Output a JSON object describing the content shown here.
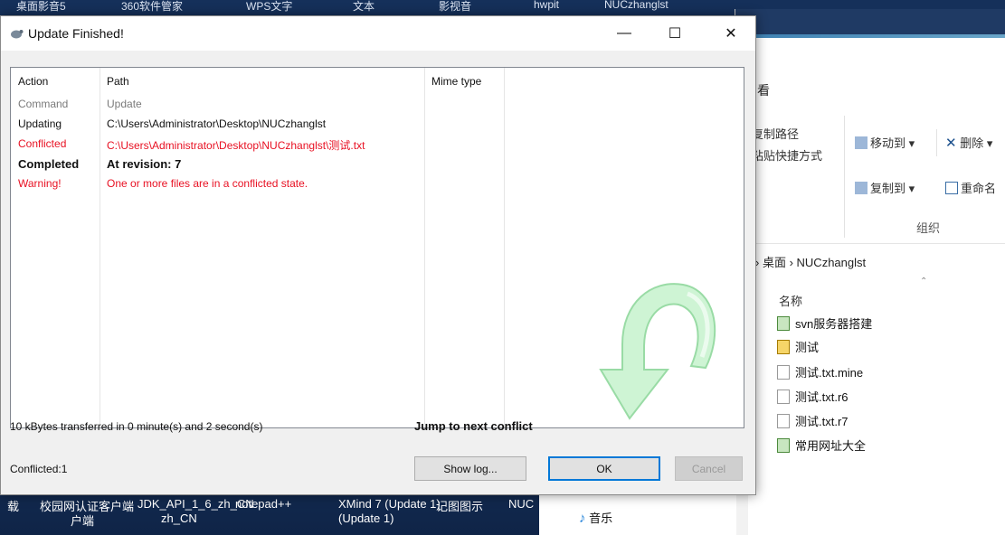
{
  "desktop": {
    "top_strip": [
      "桌面影音5",
      "360软件管家",
      "WPS文字",
      "文本",
      "影视音",
      "hwpit",
      "NUCzhanglst"
    ],
    "bottom_items": [
      "载",
      "校园网认证客户端",
      "JDK_API_1_6_zh_CN",
      "notepad++",
      "XMind 7 (Update 1)",
      "记图图示",
      "NUC"
    ],
    "bottom_labels": [
      "户端",
      "zh_CN",
      "(Update 1)"
    ]
  },
  "explorer": {
    "ribbon_tab": "看",
    "copy_path": "复制路径",
    "paste_shortcut": "粘贴快捷方式",
    "move_to": "移动到",
    "delete": "删除",
    "copy_to": "复制到",
    "rename": "重命名",
    "group_label": "组织",
    "breadcrumb": [
      "桌面",
      "NUCzhanglst"
    ],
    "column_name": "名称",
    "files": [
      {
        "name": "svn服务器搭建",
        "icon": "svn-file-icon"
      },
      {
        "name": "测试",
        "icon": "conflict-file-icon"
      },
      {
        "name": "测试.txt.mine",
        "icon": "text-file-icon"
      },
      {
        "name": "测试.txt.r6",
        "icon": "text-file-icon"
      },
      {
        "name": "测试.txt.r7",
        "icon": "text-file-icon"
      },
      {
        "name": "常用网址大全",
        "icon": "svn-file-icon"
      }
    ],
    "music": "音乐"
  },
  "dialog": {
    "title": "Update Finished!",
    "window_controls": {
      "minimize": "—",
      "maximize": "☐",
      "close": "✕"
    },
    "columns": {
      "action": "Action",
      "path": "Path",
      "mime": "Mime type"
    },
    "rows": [
      {
        "action": "Command",
        "path": "Update",
        "style": "gray"
      },
      {
        "action": "Updating",
        "path": "C:\\Users\\Administrator\\Desktop\\NUCzhanglst",
        "style": "black"
      },
      {
        "action": "Conflicted",
        "path": "C:\\Users\\Administrator\\Desktop\\NUCzhanglst\\测试.txt",
        "style": "red"
      },
      {
        "action": "Completed",
        "path": "At revision: 7",
        "style": "bold"
      },
      {
        "action": "Warning!",
        "path": "One or more files are in a conflicted state.",
        "style": "red"
      }
    ],
    "transfer_status": "10 kBytes transferred in 0 minute(s) and 2 second(s)",
    "jump_link": "Jump to next conflict",
    "conflicted_count": "Conflicted:1",
    "buttons": {
      "show_log": "Show log...",
      "ok": "OK",
      "cancel": "Cancel"
    },
    "colors": {
      "error": "#e81123",
      "accent": "#0078d7",
      "arrow": "#9be0a8"
    }
  }
}
